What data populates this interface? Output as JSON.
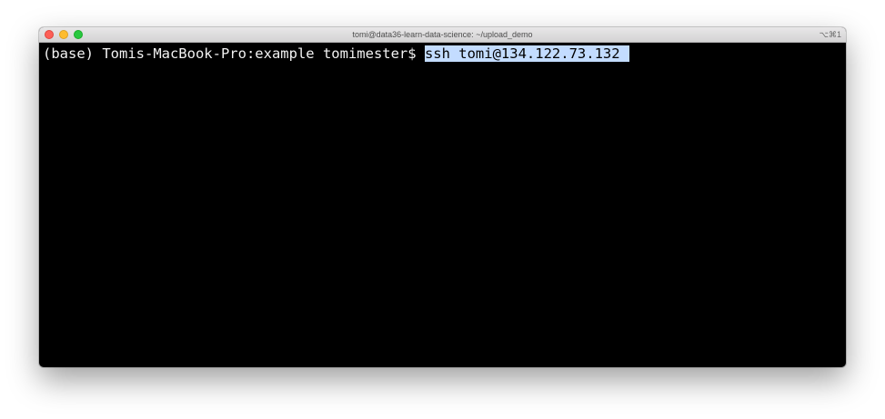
{
  "window": {
    "title": "tomi@data36-learn-data-science: ~/upload_demo",
    "shortcut": "⌥⌘1"
  },
  "terminal": {
    "prompt": "(base) Tomis-MacBook-Pro:example tomimester$ ",
    "command": "ssh tomi@134.122.73.132"
  },
  "colors": {
    "terminal_background": "#000000",
    "terminal_text": "#f2f2f2",
    "selection_highlight": "#c3dcff",
    "close_button": "#fd5f57",
    "minimize_button": "#febc2e",
    "zoom_button": "#28c840"
  }
}
